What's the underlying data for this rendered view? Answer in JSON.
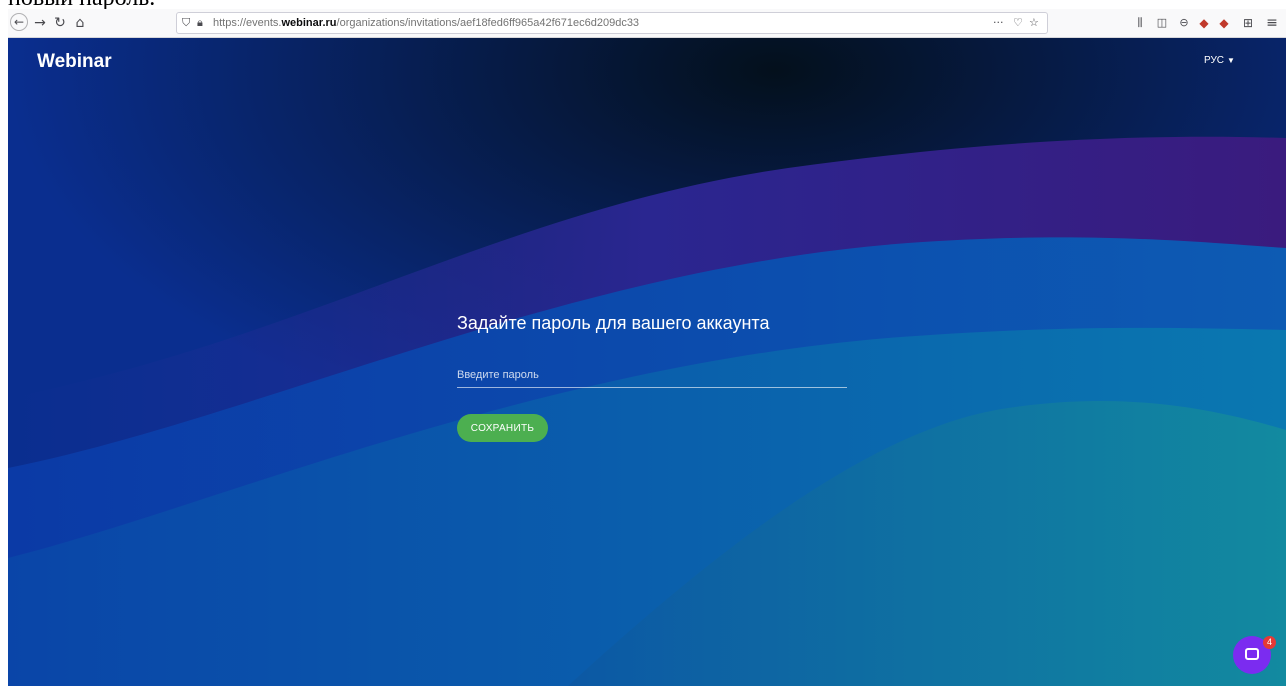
{
  "caption": "новый пароль.",
  "browser": {
    "url_prefix": "https://events.",
    "url_domain": "webinar.ru",
    "url_path": "/organizations/invitations/aef18fed6ff965a42f671ec6d209dc33",
    "icons": [
      "back-icon",
      "forward-icon",
      "reload-icon",
      "home-icon",
      "shield-icon",
      "lock-icon",
      "more-icon",
      "pocket-icon",
      "star-icon",
      "library-icon",
      "sidebar-icon",
      "account-icon",
      "extension-icon",
      "extension-icon",
      "gift-icon",
      "menu-icon"
    ]
  },
  "header": {
    "logo": "Webinar",
    "language": "РУС"
  },
  "form": {
    "title": "Задайте пароль для вашего аккаунта",
    "password_placeholder": "Введите пароль",
    "save_label": "СОХРАНИТЬ"
  },
  "chat": {
    "badge_count": "4"
  },
  "colors": {
    "accent_green": "#4caf50",
    "chat_purple": "#7b2cf0",
    "badge_red": "#e53935",
    "background_blue": "#08298b"
  }
}
